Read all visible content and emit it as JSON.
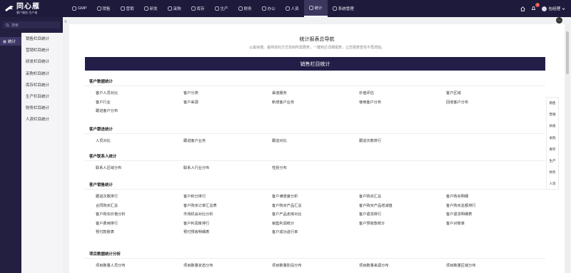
{
  "app": {
    "logo_title": "同心雁",
    "logo_sub": "客户服务·生产者"
  },
  "nav": [
    {
      "label": "GMP",
      "icon": "gmp-icon"
    },
    {
      "label": "销售",
      "icon": "chart-icon"
    },
    {
      "label": "营销",
      "icon": "bar-icon"
    },
    {
      "label": "研发",
      "icon": "flask-icon"
    },
    {
      "label": "采购",
      "icon": "cart-icon"
    },
    {
      "label": "库存",
      "icon": "box-icon"
    },
    {
      "label": "生产",
      "icon": "factory-icon"
    },
    {
      "label": "财务",
      "icon": "money-icon"
    },
    {
      "label": "办公",
      "icon": "folder-icon"
    },
    {
      "label": "人资",
      "icon": "user-icon"
    },
    {
      "label": "统计",
      "icon": "clock-icon",
      "active": true
    },
    {
      "label": "系统管理",
      "icon": "gear-icon"
    }
  ],
  "top_right": {
    "notification_count": "9",
    "user_name": "包经理"
  },
  "sidebar": {
    "search_placeholder": "搜索",
    "main_item": "统计",
    "sub_items": [
      "销售栏目统计",
      "营销栏目统计",
      "研发栏目统计",
      "采购栏目统计",
      "库存栏目统计",
      "生产栏目统计",
      "财务栏目统计",
      "人资栏目统计"
    ]
  },
  "main": {
    "title": "统计报表总导航",
    "desc": "以最快捷、最简单的方式找到所需要表，一键到达详细报表，让您报表查找不再烦恼。",
    "banner": "销售栏目统计",
    "sections": [
      {
        "title": "客户数据统计",
        "rows": [
          [
            "客户人员对比",
            "客户分类",
            "渠道服务",
            "价值评估",
            "客户区域"
          ],
          [
            "客户行业",
            "客户来源",
            "新增客户业务",
            "使用客户分布",
            "回收客户分布"
          ],
          [
            "跟进客户分布"
          ]
        ]
      },
      {
        "title": "客户跟进统计",
        "rows": [
          [
            "人员对比",
            "跟进客户业务",
            "跟进对比",
            "跟进次数排行"
          ]
        ]
      },
      {
        "title": "客户联系人统计",
        "rows": [
          [
            "联系人区域分布",
            "联系人行业分布",
            "性别分布"
          ]
        ]
      },
      {
        "title": "客户销售统计",
        "rows": [
          [
            "跟进次数排行",
            "客户积分排行",
            "客户满意度分析",
            "客户购买汇总",
            "客户购买明细"
          ],
          [
            "合同购买汇总",
            "客户购买订单汇总表",
            "客户购买产品汇总",
            "客户购买产品增减值",
            "客户购买总额排行"
          ],
          [
            "客户购买价格分析",
            "市场机会对比分析",
            "客户产品走库对比",
            "客户退货排行",
            "客户退货明细表"
          ],
          [
            "客户费用排行",
            "客户利润率排行",
            "销售利润统计",
            "客户预收款统计",
            "客户对账单"
          ],
          [
            "预付款账表",
            "预付预收明细表",
            "客户成功进行率"
          ]
        ]
      },
      {
        "title": "项目数据统计分析",
        "rows": [
          [
            "项目数量人员分布",
            "项目数量状态分布",
            "项目数量阶段分布",
            "项目数量来源分布",
            "项目数量区域分布"
          ]
        ]
      }
    ]
  },
  "quicknav": [
    "销售",
    "营销",
    "研发",
    "采购",
    "库存",
    "生产",
    "财务",
    "人资"
  ]
}
